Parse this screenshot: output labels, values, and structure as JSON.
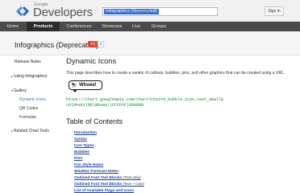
{
  "header": {
    "brand_small": "Google",
    "brand_big": "Developers",
    "search_chip": "Infographics (Deprecated)",
    "search_placeholder": "Search",
    "signin": "Sign in"
  },
  "nav": {
    "items": [
      "Home",
      "Products",
      "Conferences",
      "Showcase",
      "Live",
      "Groups"
    ],
    "active": "Products"
  },
  "title": {
    "text": "Infographics (Deprecated)",
    "plus_label": "+1",
    "plus_count": "0"
  },
  "sidebar": {
    "items": [
      "Release Notes",
      "Using Infographics",
      "Gallery",
      "Dynamic Icons",
      "QR Codes",
      "Formulas",
      "Related Chart Tools"
    ]
  },
  "content": {
    "heading": "Dynamic Icons",
    "description": "This page describes how to create a variety of callouts, bubbles, pins, and other graphics that can be created using a URL.",
    "bubble_text": "Whoee!",
    "code_line1": "https://chart.googleapis.com/chart?chst=d_bubble_icon_text_small&",
    "code_line2": "chld=ski|bb|Whoee!|FFFFFF|000000",
    "toc_heading": "Table of Contents",
    "toc": [
      {
        "label": "Introduction",
        "suffix": ""
      },
      {
        "label": "Syntax",
        "suffix": ""
      },
      {
        "label": "Icon Types",
        "suffix": ""
      },
      {
        "label": "Bubbles",
        "suffix": ""
      },
      {
        "label": "Pins",
        "suffix": ""
      },
      {
        "label": "Fun Style Notes",
        "suffix": ""
      },
      {
        "label": "Weather Forecast Notes",
        "suffix": ""
      },
      {
        "label": "Outlined Font Text Blocks",
        "suffix": " (Text only)"
      },
      {
        "label": "Outlined Font Text Blocks",
        "suffix": " (Text + icon)"
      },
      {
        "label": "List of Available Flags and Icons",
        "suffix": ""
      }
    ]
  },
  "colors": {
    "nav_bg": "#4a4a4a",
    "link": "#1a3fae",
    "code": "#0a8a2a",
    "plus_one": "#dd4b39",
    "search_chip": "#2f6fd6"
  }
}
